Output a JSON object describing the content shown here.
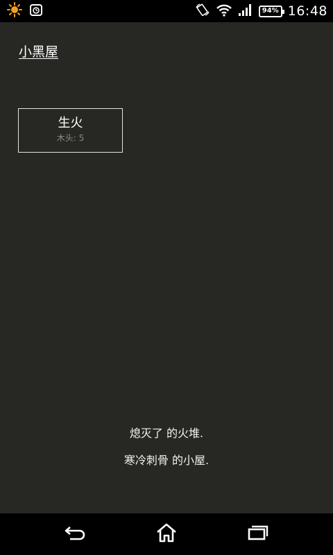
{
  "status_bar": {
    "time": "16:48",
    "battery_level": "94%",
    "icons": [
      "weather-sun-icon",
      "alarm-icon",
      "rotation-icon",
      "wifi-icon",
      "signal-icon",
      "battery-icon"
    ]
  },
  "header": {
    "location_label": "小黑屋"
  },
  "actions": [
    {
      "label": "生火",
      "cost": "木头: 5"
    }
  ],
  "notifications": [
    "熄灭了 的火堆.",
    "寒冷刺骨 的小屋."
  ],
  "nav_bar": {
    "buttons": [
      "back-icon",
      "home-icon",
      "recent-apps-icon"
    ]
  },
  "colors": {
    "background": "#272724",
    "bars": "#000000",
    "text": "#ffffff",
    "cost_text": "#8a8a86",
    "sun_icon": "#f0a020"
  }
}
